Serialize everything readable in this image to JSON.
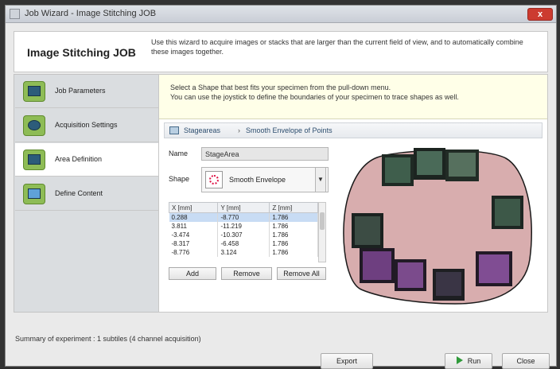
{
  "window": {
    "title": "Job Wizard - Image Stitching JOB",
    "close_label": "x"
  },
  "header": {
    "title": "Image Stitching JOB",
    "description": "Use this wizard to acquire images or stacks that are larger than the current field of view, and to automatically combine these images together."
  },
  "sidebar": {
    "items": [
      {
        "label": "Job Parameters",
        "icon": "job-parameters-icon",
        "active": false
      },
      {
        "label": "Acquisition Settings",
        "icon": "camera-icon",
        "active": false
      },
      {
        "label": "Area Definition",
        "icon": "monitor-icon",
        "active": true
      },
      {
        "label": "Define Content",
        "icon": "content-icon",
        "active": false
      }
    ]
  },
  "instructions": {
    "line1": "Select a Shape that best fits your specimen from the pull-down menu.",
    "line2": "You can use the joystick to define the boundaries of your specimen to trace shapes as well."
  },
  "breadcrumb": {
    "root": "Stageareas",
    "separator": "›",
    "current": "Smooth Envelope of Points"
  },
  "form": {
    "name_label": "Name",
    "name_value": "StageArea",
    "shape_label": "Shape",
    "shape_value": "Smooth Envelope"
  },
  "table": {
    "headers": [
      "X [mm]",
      "Y [mm]",
      "Z [mm]"
    ],
    "rows": [
      [
        "0.288",
        "-8.770",
        "1.786"
      ],
      [
        "3.811",
        "-11.219",
        "1.786"
      ],
      [
        "-3.474",
        "-10.307",
        "1.786"
      ],
      [
        "-8.317",
        "-6.458",
        "1.786"
      ],
      [
        "-8.776",
        "3.124",
        "1.786"
      ]
    ],
    "selected_row": 0
  },
  "table_buttons": {
    "add": "Add",
    "remove": "Remove",
    "remove_all": "Remove All"
  },
  "summary": "Summary of experiment : 1 subtiles (4 channel acquisition)",
  "footer": {
    "export": "Export",
    "run": "Run",
    "close": "Close"
  },
  "colors": {
    "accent_green": "#8ebc56",
    "envelope_fill": "#d8adae",
    "selected_row": "#c8dcf4"
  }
}
